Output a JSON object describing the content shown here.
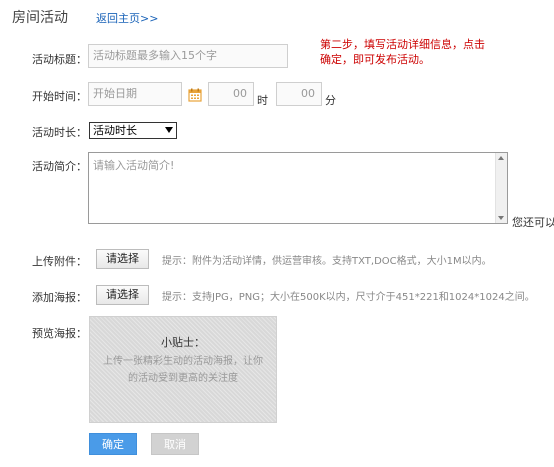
{
  "header": {
    "title": "房间活动",
    "back_link": "返回主页>>"
  },
  "hint": "第二步，填写活动详细信息，点击确定，即可发布活动。",
  "form": {
    "title_label": "活动标题：",
    "title_placeholder": "活动标题最多输入15个字",
    "start_label": "开始时间：",
    "start_date_placeholder": "开始日期",
    "hour_value": "00",
    "hour_unit": "时",
    "minute_value": "00",
    "minute_unit": "分",
    "duration_label": "活动时长：",
    "duration_selected": "活动时长",
    "intro_label": "活动简介：",
    "intro_placeholder": "请输入活动简介!",
    "intro_side_note": "您还可以",
    "attach_label": "上传附件：",
    "attach_button": "请选择",
    "attach_tip": "提示：附件为活动详情，供运营审核。支持TXT,DOC格式，大小1M以内。",
    "poster_label": "添加海报：",
    "poster_button": "请选择",
    "poster_tip": "提示：支持JPG，PNG；大小在500K以内，尺寸介于451*221和1024*1024之间。",
    "preview_label": "预览海报："
  },
  "poster_preview": {
    "title": "小贴士：",
    "line1": "上传一张精彩生动的活动海报，让你",
    "line2": "的活动受到更高的关注度"
  },
  "actions": {
    "confirm": "确定",
    "cancel": "取消"
  },
  "colors": {
    "accent": "#1a63b8",
    "hint": "#cc0000",
    "confirm_bg": "#4a9be8",
    "cancel_bg": "#d2d2d2",
    "calendar_icon": "#e8a33a"
  }
}
